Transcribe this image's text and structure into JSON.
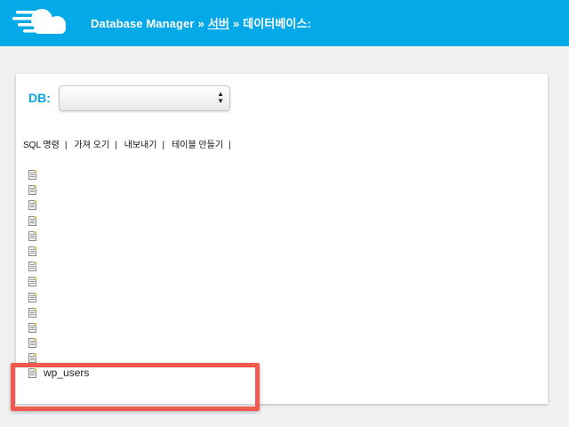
{
  "app": {
    "logo_icon": "cloud-logo-icon",
    "brand_color": "#06a9e8"
  },
  "breadcrumb": {
    "app_name": "Database Manager",
    "separator": "»",
    "server_label": "서버",
    "current": "데이터베이스:"
  },
  "db_selector": {
    "label": "DB:",
    "selected": ""
  },
  "menu": {
    "items": [
      {
        "label": "SQL 명령"
      },
      {
        "label": "가져 오기"
      },
      {
        "label": "내보내기"
      },
      {
        "label": "테이블 만들기"
      }
    ],
    "separator": "|"
  },
  "tables": [
    {
      "name": ""
    },
    {
      "name": ""
    },
    {
      "name": ""
    },
    {
      "name": ""
    },
    {
      "name": ""
    },
    {
      "name": ""
    },
    {
      "name": ""
    },
    {
      "name": ""
    },
    {
      "name": ""
    },
    {
      "name": ""
    },
    {
      "name": ""
    },
    {
      "name": ""
    },
    {
      "name": ""
    },
    {
      "name": "wp_users"
    }
  ],
  "highlight_color": "#f25a50"
}
